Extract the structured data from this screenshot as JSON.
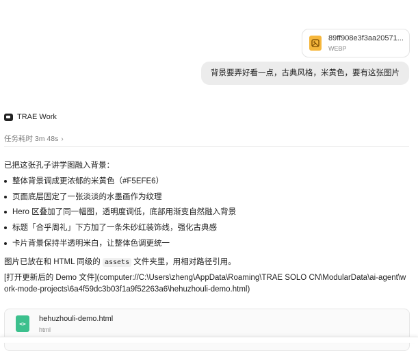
{
  "attachment": {
    "name": "89ff908e3f3aa20571...",
    "type": "WEBP",
    "icon": "image-file-icon"
  },
  "user_message": "背景要弄好看一点，古典风格，米黄色，要有这张图片",
  "agent": {
    "name": "TRAE Work",
    "duration_label": "任务耗时 3m 48s"
  },
  "response": {
    "intro": "已把这张孔子讲学图融入背景：",
    "bullets": [
      "整体背景调成更浓郁的米黄色（#F5EFE6）",
      "页面底层固定了一张淡淡的水墨画作为纹理",
      "Hero 区叠加了同一幅图，透明度调低，底部用渐变自然融入背景",
      "标题「合乎周礼」下方加了一条朱砂红装饰线，强化古典感",
      "卡片背景保持半透明米白，让整体色调更统一"
    ],
    "para_before": "图片已放在和 HTML 同级的 ",
    "para_code": "assets",
    "para_after": " 文件夹里，用相对路径引用。",
    "link": "[打开更新后的 Demo 文件](computer://C:\\Users\\zheng\\AppData\\Roaming\\TRAE SOLO CN\\ModularData\\ai-agent\\work-mode-projects\\6a4f59dc3b03f1a9f52263a6\\hehuzhouli-demo.html)"
  },
  "file_card": {
    "name": "hehuzhouli-demo.html",
    "type": "html",
    "icon": "code-file-icon"
  }
}
